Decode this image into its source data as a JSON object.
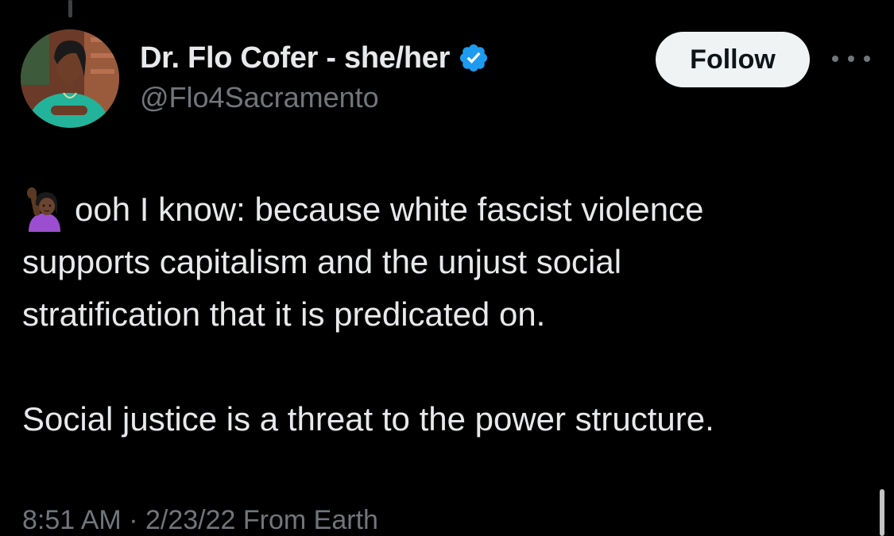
{
  "tweet": {
    "display_name": "Dr. Flo Cofer - she/her",
    "handle": "@Flo4Sacramento",
    "follow_label": "Follow",
    "verified": true,
    "lines": [
      "ooh I know: because white fascist violence",
      "supports capitalism and the unjust social",
      "stratification that it is predicated on.",
      "Social justice is a threat to the power structure."
    ],
    "leading_emoji": "raising-hand-person-emoji",
    "time": "8:51 AM",
    "date": "2/23/22",
    "separator": "·",
    "source": "From Earth"
  },
  "icons": {
    "verified": "verified-badge-icon",
    "more": "more-options-icon"
  },
  "colors": {
    "background": "#000000",
    "text_primary": "#e7e9ea",
    "text_secondary": "#71767b",
    "verified_blue": "#1d9bf0",
    "follow_button_bg": "#eff3f4",
    "follow_button_text": "#0f1419"
  }
}
